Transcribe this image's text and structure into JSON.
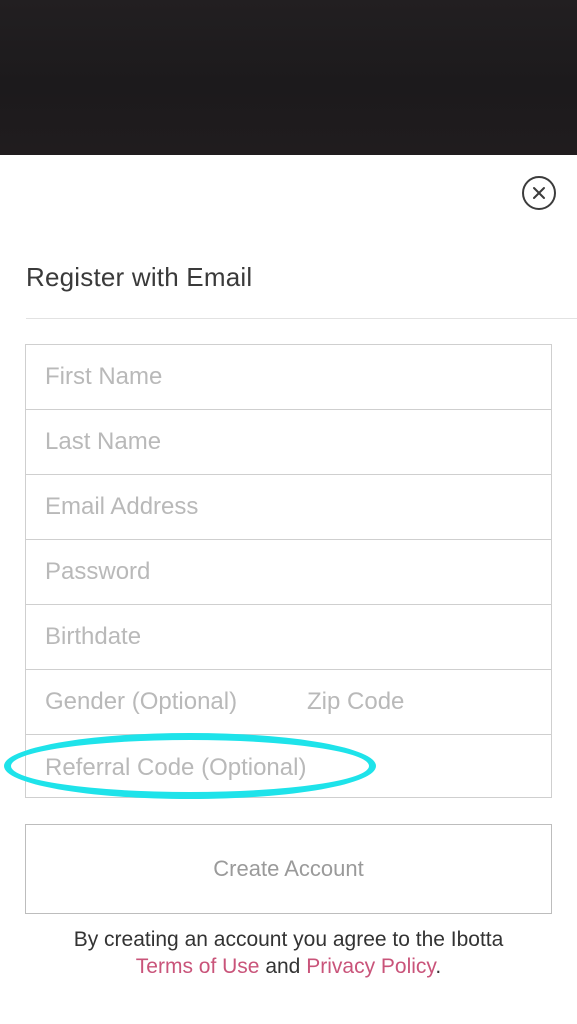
{
  "modal": {
    "close_icon": "close-icon",
    "title": "Register with Email"
  },
  "form": {
    "first_name": {
      "placeholder": "First Name",
      "value": ""
    },
    "last_name": {
      "placeholder": "Last Name",
      "value": ""
    },
    "email": {
      "placeholder": "Email Address",
      "value": ""
    },
    "password": {
      "placeholder": "Password",
      "value": ""
    },
    "birthdate": {
      "placeholder": "Birthdate",
      "value": ""
    },
    "gender": {
      "placeholder": "Gender (Optional)",
      "value": ""
    },
    "zip": {
      "placeholder": "Zip Code",
      "value": ""
    },
    "referral": {
      "placeholder": "Referral Code (Optional)",
      "value": ""
    }
  },
  "actions": {
    "create_account_label": "Create Account"
  },
  "legal": {
    "prefix": "By creating an account you agree to the Ibotta",
    "terms_label": "Terms of Use",
    "conjunction": "and",
    "privacy_label": "Privacy Policy",
    "suffix": "."
  },
  "colors": {
    "link": "#c9547a",
    "highlight": "#1ee3ea",
    "backdrop": "#1e1b1d"
  }
}
